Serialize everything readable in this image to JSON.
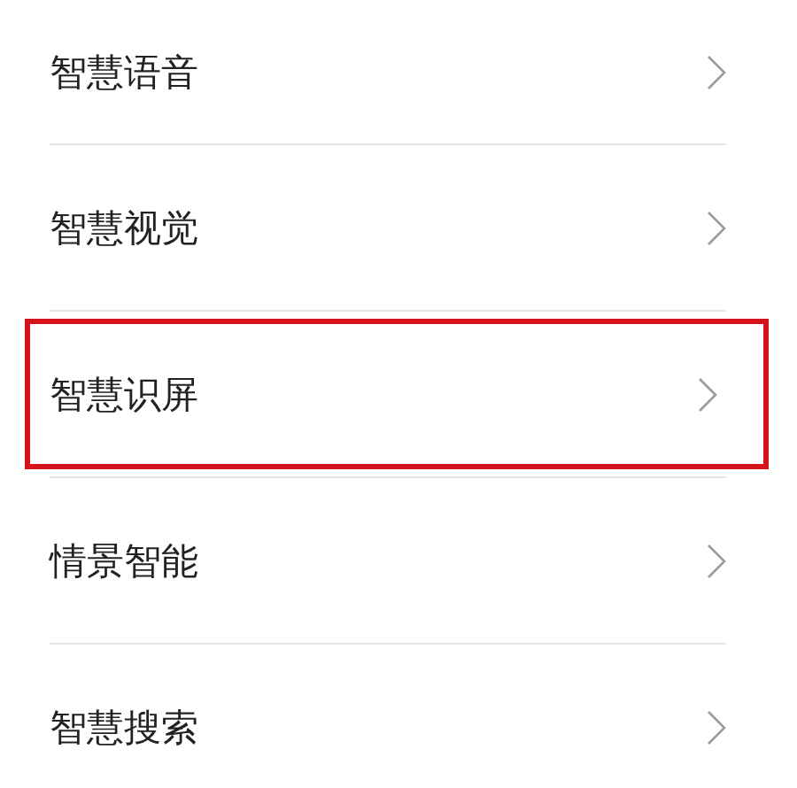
{
  "items": [
    {
      "label": "智慧语音",
      "highlighted": false
    },
    {
      "label": "智慧视觉",
      "highlighted": false
    },
    {
      "label": "智慧识屏",
      "highlighted": true
    },
    {
      "label": "情景智能",
      "highlighted": false
    },
    {
      "label": "智慧搜索",
      "highlighted": false
    }
  ]
}
